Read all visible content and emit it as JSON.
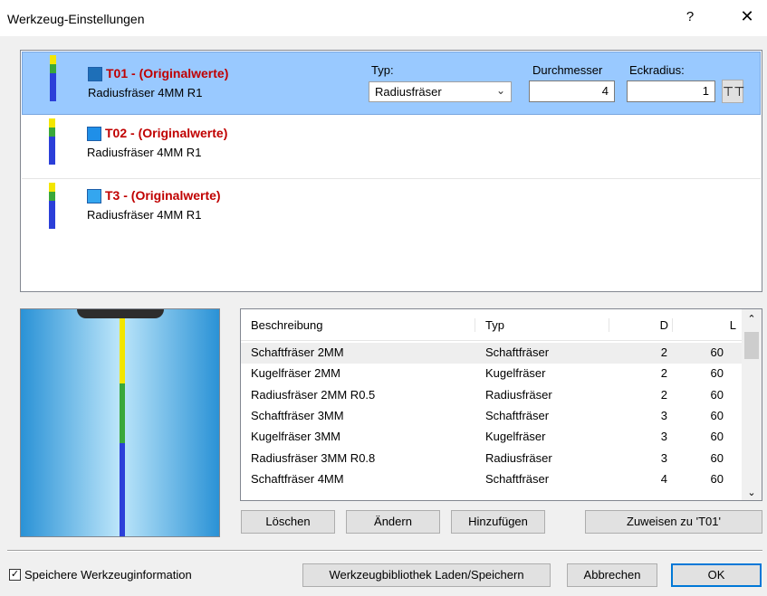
{
  "window": {
    "title": "Werkzeug-Einstellungen",
    "help": "?",
    "close": "✕"
  },
  "tools": [
    {
      "name": "T01 - (Originalwerte)",
      "desc": "Radiusfräser 4MM R1",
      "color": "#1e6fb8"
    },
    {
      "name": "T02 - (Originalwerte)",
      "desc": "Radiusfräser 4MM R1",
      "color": "#1f8fe8"
    },
    {
      "name": "T3 - (Originalwerte)",
      "desc": "Radiusfräser 4MM R1",
      "color": "#34a6ef"
    }
  ],
  "editor": {
    "typ_label": "Typ:",
    "typ_value": "Radiusfräser",
    "durchmesser_label": "Durchmesser",
    "durchmesser_value": "4",
    "eckradius_label": "Eckradius:",
    "eckradius_value": "1"
  },
  "library": {
    "columns": [
      "Beschreibung",
      "Typ",
      "D",
      "L"
    ],
    "rows": [
      [
        "Schaftfräser 2MM",
        "Schaftfräser",
        "2",
        "60"
      ],
      [
        "Kugelfräser 2MM",
        "Kugelfräser",
        "2",
        "60"
      ],
      [
        "Radiusfräser 2MM R0.5",
        "Radiusfräser",
        "2",
        "60"
      ],
      [
        "Schaftfräser 3MM",
        "Schaftfräser",
        "3",
        "60"
      ],
      [
        "Kugelfräser 3MM",
        "Kugelfräser",
        "3",
        "60"
      ],
      [
        "Radiusfräser 3MM R0.8",
        "Radiusfräser",
        "3",
        "60"
      ],
      [
        "Schaftfräser 4MM",
        "Schaftfräser",
        "4",
        "60"
      ]
    ]
  },
  "buttons": {
    "loeschen": "Löschen",
    "aendern": "Ändern",
    "hinzufuegen": "Hinzufügen",
    "zuweisen": "Zuweisen zu 'T01'",
    "bibliothek": "Werkzeugbibliothek Laden/Speichern",
    "abbrechen": "Abbrechen",
    "ok": "OK"
  },
  "checkbox": {
    "label": "Speichere Werkzeuginformation",
    "checked": true
  }
}
